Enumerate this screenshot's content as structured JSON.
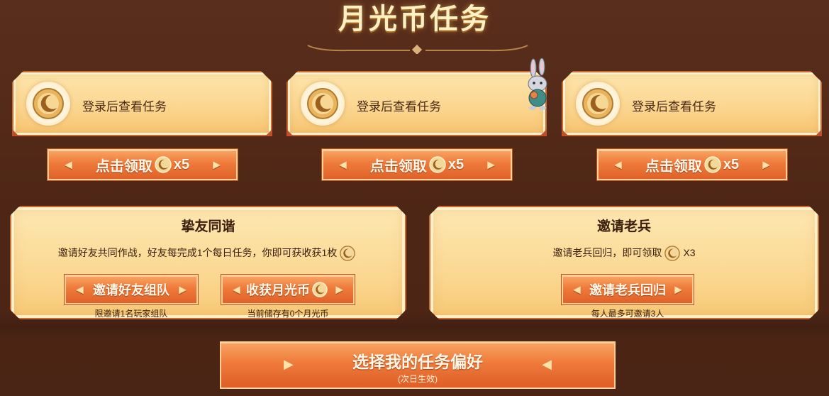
{
  "header": {
    "title": "月光币任务"
  },
  "tasks": [
    {
      "text": "登录后查看任务",
      "claim_label": "点击领取",
      "reward": "x5"
    },
    {
      "text": "登录后查看任务",
      "claim_label": "点击领取",
      "reward": "x5"
    },
    {
      "text": "登录后查看任务",
      "claim_label": "点击领取",
      "reward": "x5"
    }
  ],
  "team_panel": {
    "title": "挚友同谐",
    "description": "邀请好友共同作战，好友每完成1个每日任务，你即可获收获1枚",
    "invite_button": "邀请好友组队",
    "invite_note": "限邀请1名玩家组队",
    "collect_button": "收获月光币",
    "collect_note": "当前储存有0个月光币"
  },
  "veteran_panel": {
    "title": "邀请老兵",
    "description": "邀请老兵回归，即可领取",
    "reward": "X3",
    "invite_button": "邀请老兵回归",
    "note": "每人最多可邀请3人"
  },
  "preference": {
    "label": "选择我的任务偏好",
    "sublabel": "(次日生效)"
  },
  "icons": {
    "coin": "moon-coin-icon",
    "mascot": "rabbit-mascot-icon",
    "arrows": "chevron-icon"
  },
  "colors": {
    "accent": "#ee7a3a",
    "card": "#fbd690",
    "background": "#4e2615"
  }
}
